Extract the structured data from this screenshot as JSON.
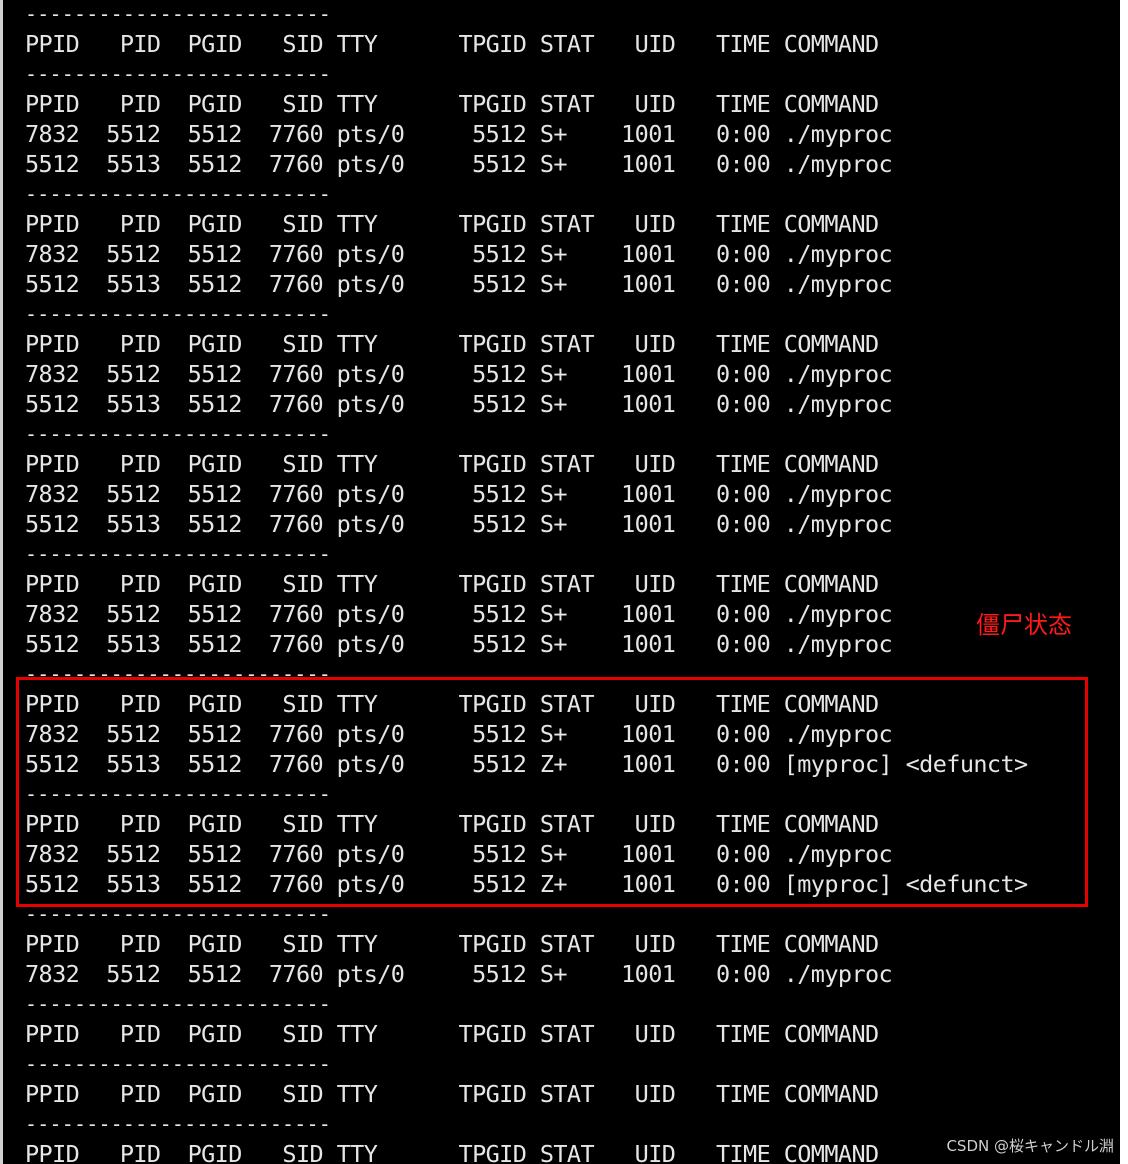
{
  "terminal": {
    "lines": [
      "-------------------------",
      "PPID   PID  PGID   SID TTY      TPGID STAT   UID   TIME COMMAND",
      "-------------------------",
      "PPID   PID  PGID   SID TTY      TPGID STAT   UID   TIME COMMAND",
      "7832  5512  5512  7760 pts/0     5512 S+    1001   0:00 ./myproc",
      "5512  5513  5512  7760 pts/0     5512 S+    1001   0:00 ./myproc",
      "-------------------------",
      "PPID   PID  PGID   SID TTY      TPGID STAT   UID   TIME COMMAND",
      "7832  5512  5512  7760 pts/0     5512 S+    1001   0:00 ./myproc",
      "5512  5513  5512  7760 pts/0     5512 S+    1001   0:00 ./myproc",
      "-------------------------",
      "PPID   PID  PGID   SID TTY      TPGID STAT   UID   TIME COMMAND",
      "7832  5512  5512  7760 pts/0     5512 S+    1001   0:00 ./myproc",
      "5512  5513  5512  7760 pts/0     5512 S+    1001   0:00 ./myproc",
      "-------------------------",
      "PPID   PID  PGID   SID TTY      TPGID STAT   UID   TIME COMMAND",
      "7832  5512  5512  7760 pts/0     5512 S+    1001   0:00 ./myproc",
      "5512  5513  5512  7760 pts/0     5512 S+    1001   0:00 ./myproc",
      "-------------------------",
      "PPID   PID  PGID   SID TTY      TPGID STAT   UID   TIME COMMAND",
      "7832  5512  5512  7760 pts/0     5512 S+    1001   0:00 ./myproc",
      "5512  5513  5512  7760 pts/0     5512 S+    1001   0:00 ./myproc",
      "-------------------------",
      "PPID   PID  PGID   SID TTY      TPGID STAT   UID   TIME COMMAND",
      "7832  5512  5512  7760 pts/0     5512 S+    1001   0:00 ./myproc",
      "5512  5513  5512  7760 pts/0     5512 Z+    1001   0:00 [myproc] <defunct>",
      "-------------------------",
      "PPID   PID  PGID   SID TTY      TPGID STAT   UID   TIME COMMAND",
      "7832  5512  5512  7760 pts/0     5512 S+    1001   0:00 ./myproc",
      "5512  5513  5512  7760 pts/0     5512 Z+    1001   0:00 [myproc] <defunct>",
      "-------------------------",
      "PPID   PID  PGID   SID TTY      TPGID STAT   UID   TIME COMMAND",
      "7832  5512  5512  7760 pts/0     5512 S+    1001   0:00 ./myproc",
      "-------------------------",
      "PPID   PID  PGID   SID TTY      TPGID STAT   UID   TIME COMMAND",
      "-------------------------",
      "PPID   PID  PGID   SID TTY      TPGID STAT   UID   TIME COMMAND",
      "-------------------------",
      "PPID   PID  PGID   SID TTY      TPGID STAT   UID   TIME COMMAND"
    ]
  },
  "annotation": {
    "label": "僵尸状态",
    "color": "#e60000"
  },
  "watermark": "CSDN @桜キャンドル淵",
  "colors": {
    "background": "#000000",
    "text": "#e6e6e6"
  }
}
